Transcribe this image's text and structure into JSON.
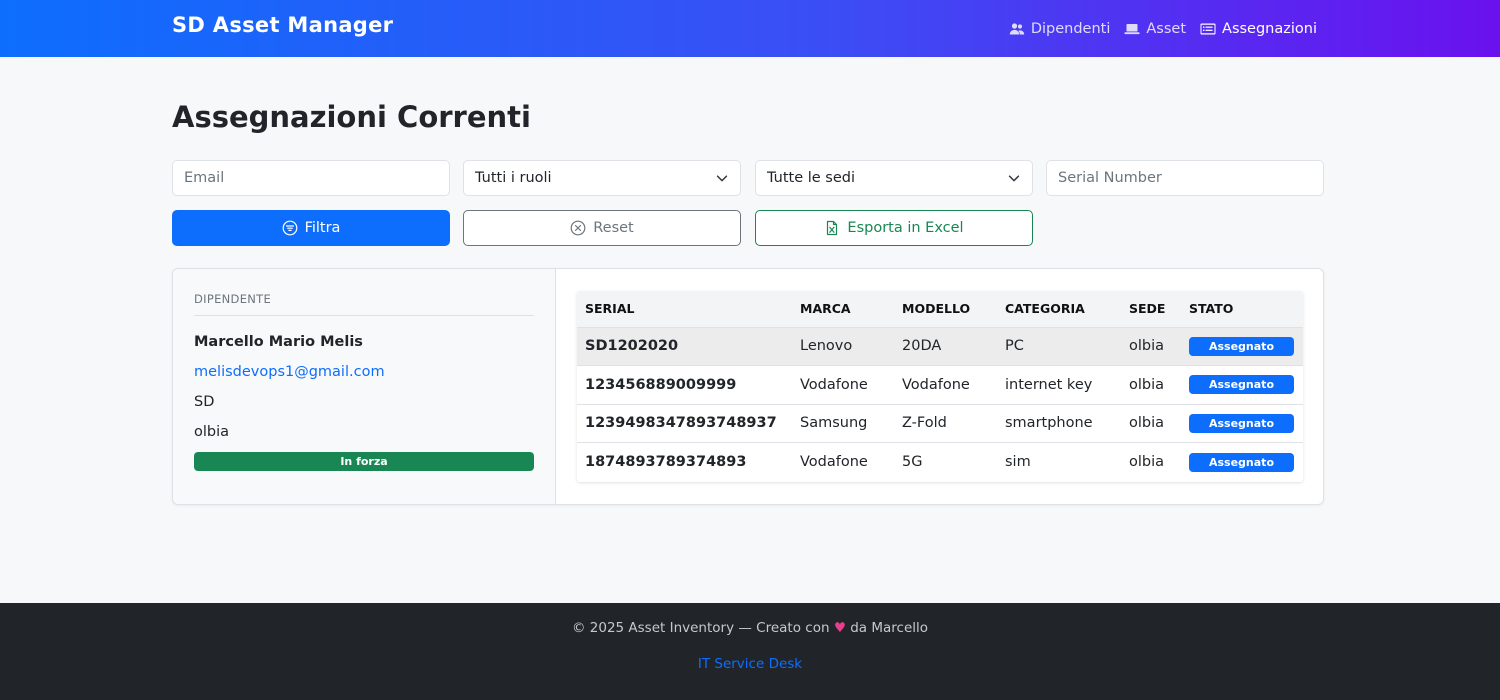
{
  "navbar": {
    "brand": "SD Asset Manager",
    "links": [
      {
        "label": "Dipendenti",
        "icon": "users-icon"
      },
      {
        "label": "Asset",
        "icon": "laptop-icon"
      },
      {
        "label": "Assegnazioni",
        "icon": "card-list-icon",
        "active": true
      }
    ]
  },
  "page": {
    "title": "Assegnazioni Correnti"
  },
  "filters": {
    "email_placeholder": "Email",
    "role_select": "Tutti i ruoli",
    "site_select": "Tutte le sedi",
    "serial_placeholder": "Serial Number",
    "filter_button": "Filtra",
    "reset_button": "Reset",
    "export_button": "Esporta in Excel"
  },
  "employee": {
    "header": "DIPENDENTE",
    "name": "Marcello Mario Melis",
    "email": "melisdevops1@gmail.com",
    "company": "SD",
    "site": "olbia",
    "status": "In forza"
  },
  "table": {
    "headers": [
      "SERIAL",
      "MARCA",
      "MODELLO",
      "CATEGORIA",
      "SEDE",
      "STATO"
    ],
    "rows": [
      {
        "serial": "SD1202020",
        "marca": "Lenovo",
        "modello": "20DA",
        "categoria": "PC",
        "sede": "olbia",
        "stato": "Assegnato"
      },
      {
        "serial": "123456889009999",
        "marca": "Vodafone",
        "modello": "Vodafone",
        "categoria": "internet key",
        "sede": "olbia",
        "stato": "Assegnato"
      },
      {
        "serial": "1239498347893748937",
        "marca": "Samsung",
        "modello": "Z-Fold",
        "categoria": "smartphone",
        "sede": "olbia",
        "stato": "Assegnato"
      },
      {
        "serial": "1874893789374893",
        "marca": "Vodafone",
        "modello": "5G",
        "categoria": "sim",
        "sede": "olbia",
        "stato": "Assegnato"
      }
    ]
  },
  "footer": {
    "text_before": "© 2025 Asset Inventory — Creato con",
    "text_after": "da Marcello",
    "link": "IT Service Desk"
  },
  "colors": {
    "primary": "#0d6efd",
    "success": "#198754",
    "nav_gradient_end": "#6a11ee",
    "footer_bg": "#212529"
  }
}
